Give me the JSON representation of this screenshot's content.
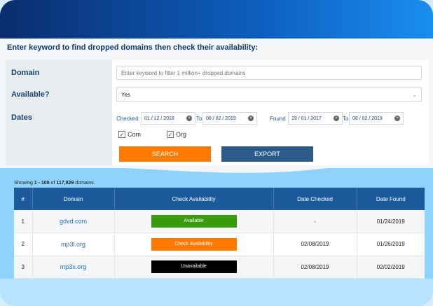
{
  "heading": "Enter keyword to find dropped domains then check their availability:",
  "form": {
    "domain_label": "Domain",
    "domain_placeholder": "Enter keyword to filter 1 million+ dropped domains",
    "available_label": "Available?",
    "available_value": "Yes",
    "dates_label": "Dates",
    "checked_label": "Checked",
    "checked_from": "01 / 12 / 2018",
    "to_label_1": "To",
    "checked_to": "08 / 02 / 2019",
    "found_label": "Found",
    "found_from": "19 / 01 / 2017",
    "to_label_2": "To",
    "found_to": "08 / 02 / 2019",
    "com_label": "Com",
    "org_label": "Org",
    "search_label": "SEARCH",
    "export_label": "EXPORT"
  },
  "results": {
    "prefix": "Showing ",
    "range": "1 - 100",
    "of": " of ",
    "total": "117,929",
    "suffix": " domains."
  },
  "table": {
    "headers": [
      "#",
      "Domain",
      "Check Availability",
      "Date Checked",
      "Date Found"
    ],
    "rows": [
      {
        "num": "1",
        "domain": "gdvd.com",
        "status": "Available",
        "checked": "-",
        "found": "01/24/2019"
      },
      {
        "num": "2",
        "domain": "mp3l.org",
        "status": "Check Availability",
        "checked": "02/08/2019",
        "found": "01/26/2019"
      },
      {
        "num": "3",
        "domain": "mp3x.org",
        "status": "Unavailable",
        "checked": "02/08/2019",
        "found": "02/02/2019"
      }
    ]
  },
  "colors": {
    "available": "#3a9a0c",
    "check": "#ff7a00",
    "unavailable": "#000000"
  }
}
